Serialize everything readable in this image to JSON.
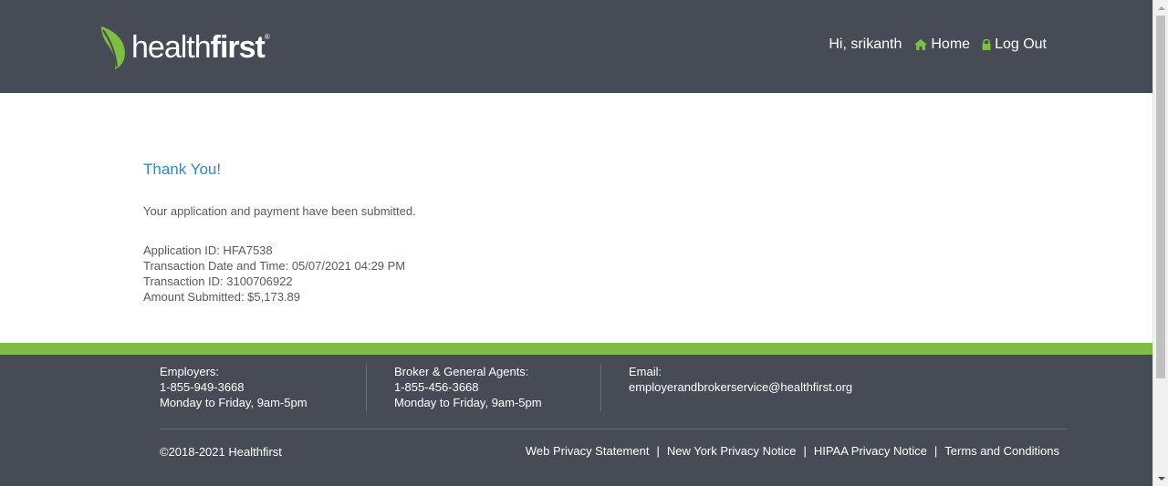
{
  "header": {
    "logo_text_light": "health",
    "logo_text_bold": "first",
    "logo_registered": "®",
    "greeting": "Hi, srikanth",
    "home_label": "Home",
    "logout_label": "Log Out",
    "home_icon": "home-icon",
    "logout_icon": "lock-icon"
  },
  "main": {
    "title": "Thank You!",
    "message": "Your application and payment have been submitted.",
    "details": {
      "application_id": "Application ID: HFA7538",
      "transaction_datetime": "Transaction Date and Time: 05/07/2021 04:29 PM",
      "transaction_id": "Transaction ID: 3100706922",
      "amount": "Amount Submitted:  $5,173.89"
    }
  },
  "footer": {
    "employers": {
      "label": "Employers:",
      "phone": "1-855-949-3668",
      "hours": "Monday to Friday, 9am-5pm"
    },
    "brokers": {
      "label": "Broker & General Agents:",
      "phone": "1-855-456-3668",
      "hours": "Monday to Friday, 9am-5pm"
    },
    "email": {
      "label": "Email:",
      "address": "employerandbrokerservice@healthfirst.org"
    },
    "copyright": "©2018-2021 Healthfirst",
    "links": [
      "Web Privacy Statement",
      "New York Privacy Notice",
      "HIPAA Privacy Notice",
      "Terms and Conditions"
    ],
    "separator": "|"
  },
  "colors": {
    "header_bg": "#474b55",
    "accent_green": "#7cbf42",
    "title_blue": "#2b8cc4",
    "body_text": "#555a63"
  }
}
